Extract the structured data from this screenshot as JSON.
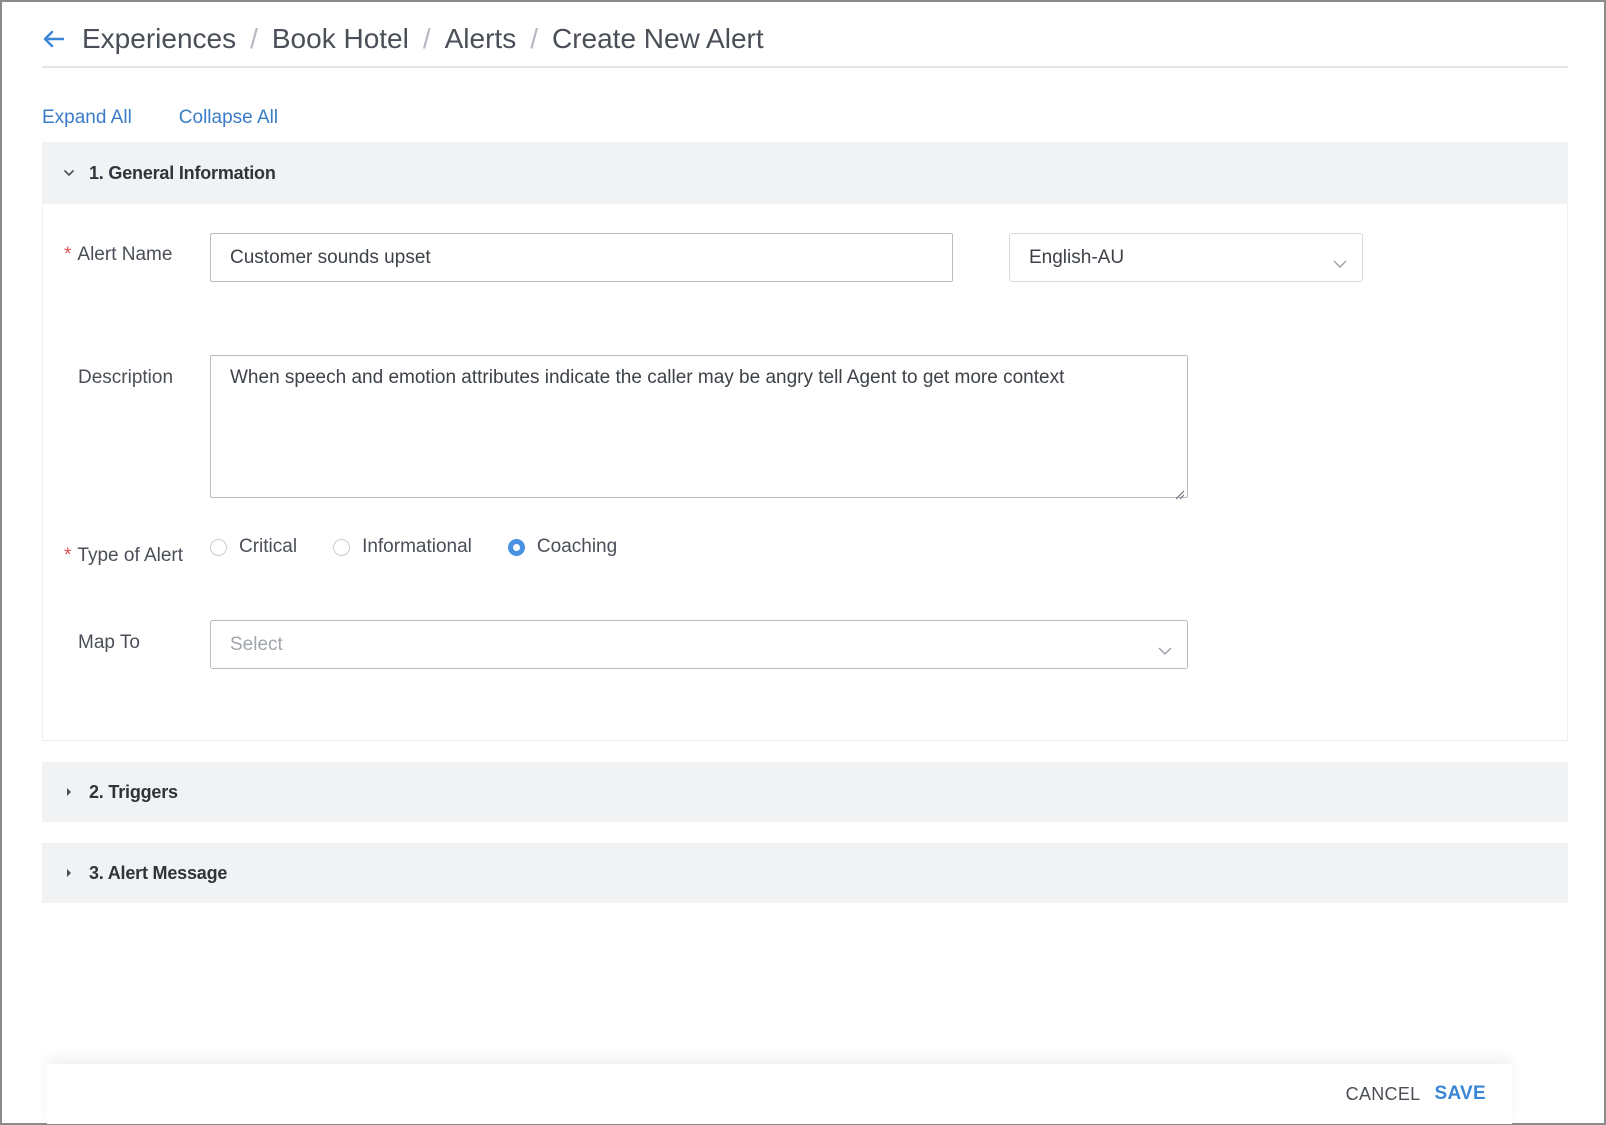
{
  "breadcrumb": {
    "items": [
      "Experiences",
      "Book Hotel",
      "Alerts"
    ],
    "current": "Create New Alert",
    "separator": "/"
  },
  "toolbar": {
    "expand_all": "Expand All",
    "collapse_all": "Collapse All"
  },
  "sections": [
    {
      "title": "1. General Information",
      "expanded": true
    },
    {
      "title": "2. Triggers",
      "expanded": false
    },
    {
      "title": "3. Alert Message",
      "expanded": false
    }
  ],
  "form": {
    "alert_name": {
      "label": "Alert Name",
      "required_mark": "*",
      "value": "Customer sounds upset"
    },
    "language": {
      "value": "English-AU"
    },
    "description": {
      "label": "Description",
      "value": "When speech and emotion attributes indicate the caller may be angry tell Agent to get more context"
    },
    "alert_type": {
      "label": "Type of Alert",
      "required_mark": "*",
      "options": [
        "Critical",
        "Informational",
        "Coaching"
      ],
      "selected": "Coaching"
    },
    "map_to": {
      "label": "Map To",
      "placeholder": "Select"
    }
  },
  "footer": {
    "cancel_label": "CANCEL",
    "save_label": "SAVE"
  },
  "colors": {
    "accent": "#3a86d6",
    "link": "#3a7cc7",
    "required": "#e0524f",
    "panel_header_bg": "#f1f2f4",
    "radio_selected": "#4a90e2"
  },
  "icons": {
    "back": "arrow-left-icon",
    "section_expanded": "chevron-down-icon",
    "section_collapsed": "caret-right-icon",
    "dropdown": "chevron-down-icon"
  }
}
